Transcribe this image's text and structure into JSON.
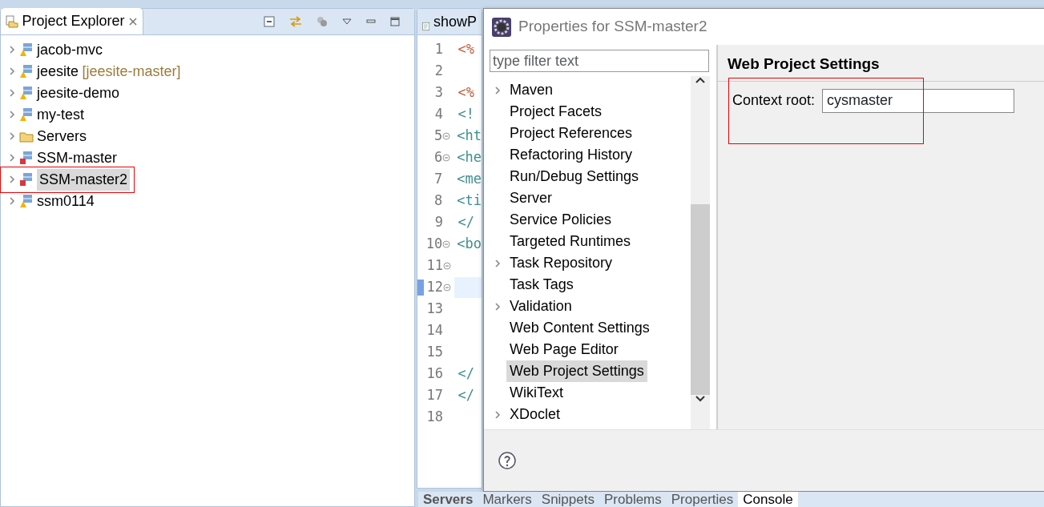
{
  "explorer": {
    "title": "Project Explorer",
    "items": [
      {
        "label": "jacob-mvc",
        "kind": "warning",
        "selected": false
      },
      {
        "label": "jeesite",
        "suffix": "[jeesite-master]",
        "kind": "warning",
        "selected": false
      },
      {
        "label": "jeesite-demo",
        "kind": "warning",
        "selected": false
      },
      {
        "label": "my-test",
        "kind": "warning",
        "selected": false
      },
      {
        "label": "Servers",
        "kind": "folder",
        "selected": false
      },
      {
        "label": "SSM-master",
        "kind": "error",
        "selected": false
      },
      {
        "label": "SSM-master2",
        "kind": "error",
        "selected": true
      },
      {
        "label": "ssm0114",
        "kind": "warning",
        "selected": false
      }
    ]
  },
  "editor": {
    "tab": "showP",
    "lines": [
      {
        "number": "1",
        "code": "<%",
        "kind": "directive",
        "fold": false,
        "current": false
      },
      {
        "number": "2",
        "fold": false,
        "current": false
      },
      {
        "number": "3",
        "code": "<%",
        "kind": "directive",
        "fold": false,
        "current": false
      },
      {
        "number": "4",
        "code": "<!",
        "kind": "tag",
        "fold": false,
        "current": false
      },
      {
        "number": "5",
        "code": "<ht",
        "kind": "tag",
        "fold": true,
        "current": false
      },
      {
        "number": "6",
        "code": "<he",
        "kind": "tag",
        "fold": true,
        "current": false
      },
      {
        "number": "7",
        "code": "<me",
        "kind": "tag",
        "fold": false,
        "current": false
      },
      {
        "number": "8",
        "code": "<ti",
        "kind": "tag",
        "fold": false,
        "current": false
      },
      {
        "number": "9",
        "code": "</",
        "kind": "tag",
        "fold": false,
        "current": false
      },
      {
        "number": "10",
        "code": "<bo",
        "kind": "tag",
        "fold": true,
        "current": false
      },
      {
        "number": "11",
        "fold": true,
        "current": false
      },
      {
        "number": "12",
        "fold": true,
        "current": true
      },
      {
        "number": "13",
        "fold": false,
        "current": false
      },
      {
        "number": "14",
        "fold": false,
        "current": false
      },
      {
        "number": "15",
        "fold": false,
        "current": false
      },
      {
        "number": "16",
        "code": "</",
        "kind": "tag",
        "fold": false,
        "current": false
      },
      {
        "number": "17",
        "code": "</",
        "kind": "tag",
        "fold": false,
        "current": false
      },
      {
        "number": "18",
        "fold": false,
        "current": false
      }
    ]
  },
  "dialog": {
    "title": "Properties for SSM-master2",
    "filter": {
      "placeholder": "type filter text"
    },
    "pages": [
      {
        "label": "Maven",
        "expandable": true,
        "selected": false
      },
      {
        "label": "Project Facets",
        "expandable": false,
        "selected": false
      },
      {
        "label": "Project References",
        "expandable": false,
        "selected": false
      },
      {
        "label": "Refactoring History",
        "expandable": false,
        "selected": false
      },
      {
        "label": "Run/Debug Settings",
        "expandable": false,
        "selected": false
      },
      {
        "label": "Server",
        "expandable": false,
        "selected": false
      },
      {
        "label": "Service Policies",
        "expandable": false,
        "selected": false
      },
      {
        "label": "Targeted Runtimes",
        "expandable": false,
        "selected": false
      },
      {
        "label": "Task Repository",
        "expandable": true,
        "selected": false
      },
      {
        "label": "Task Tags",
        "expandable": false,
        "selected": false
      },
      {
        "label": "Validation",
        "expandable": true,
        "selected": false
      },
      {
        "label": "Web Content Settings",
        "expandable": false,
        "selected": false
      },
      {
        "label": "Web Page Editor",
        "expandable": false,
        "selected": false
      },
      {
        "label": "Web Project Settings",
        "expandable": false,
        "selected": true
      },
      {
        "label": "WikiText",
        "expandable": false,
        "selected": false
      },
      {
        "label": "XDoclet",
        "expandable": true,
        "selected": false
      }
    ],
    "page_title": "Web Project Settings",
    "field": {
      "label": "Context root:",
      "value": "cysmaster"
    }
  },
  "bottom_tabs": [
    {
      "label": "Servers",
      "bold": true,
      "selected": false
    },
    {
      "label": "Markers",
      "bold": false,
      "selected": false
    },
    {
      "label": "Snippets",
      "bold": false,
      "selected": false
    },
    {
      "label": "Problems",
      "bold": false,
      "selected": false
    },
    {
      "label": "Properties",
      "bold": false,
      "selected": false
    },
    {
      "label": "Console",
      "bold": false,
      "selected": true
    }
  ]
}
